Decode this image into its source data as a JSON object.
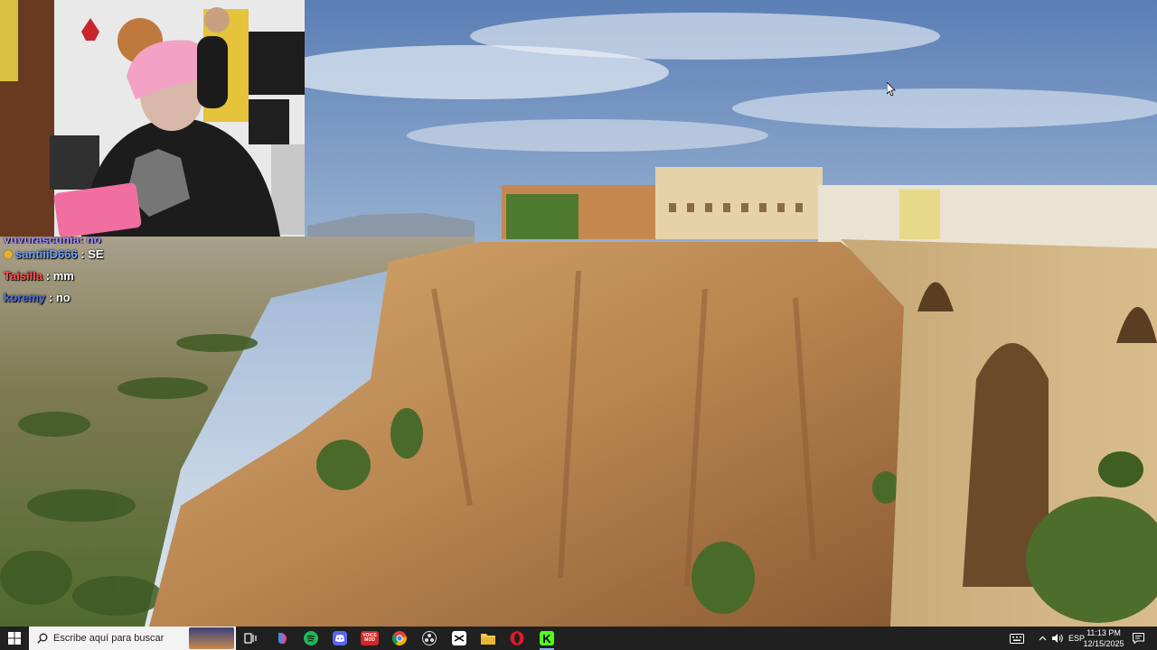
{
  "chat": {
    "partial_line": "yuyurascunia: no",
    "messages": [
      {
        "user": "santiiiD666",
        "text": ": SE",
        "user_color": "#6fa0ff",
        "badge": true
      },
      {
        "user": "Taisilla",
        "text": ": mm",
        "user_color": "#ff5050",
        "badge": false
      },
      {
        "user": "koremy",
        "text": ": no",
        "user_color": "#5070e0",
        "badge": false
      }
    ]
  },
  "taskbar": {
    "search_placeholder": "Escribe aquí para buscar",
    "apps": [
      {
        "name": "task-view",
        "label": "",
        "color": "#ffffff"
      },
      {
        "name": "copilot",
        "label": "",
        "color": "#4aa3ff"
      },
      {
        "name": "spotify",
        "label": "",
        "color": "#1db954"
      },
      {
        "name": "discord",
        "label": "",
        "color": "#5865f2"
      },
      {
        "name": "voicemod",
        "label": "VOICE\nMOD",
        "color": "#d32626"
      },
      {
        "name": "chrome",
        "label": "",
        "color": "#e8b400"
      },
      {
        "name": "obs-studio",
        "label": "",
        "color": "#3a3a3a"
      },
      {
        "name": "capcut",
        "label": "",
        "color": "#ffffff"
      },
      {
        "name": "file-explorer",
        "label": "",
        "color": "#f2c84b"
      },
      {
        "name": "opera",
        "label": "",
        "color": "#e01b2c"
      },
      {
        "name": "kick",
        "label": "K",
        "color": "#53fc18"
      }
    ],
    "tray": {
      "language": "ESP",
      "time": "11:13 PM",
      "date": "12/15/2025"
    }
  }
}
